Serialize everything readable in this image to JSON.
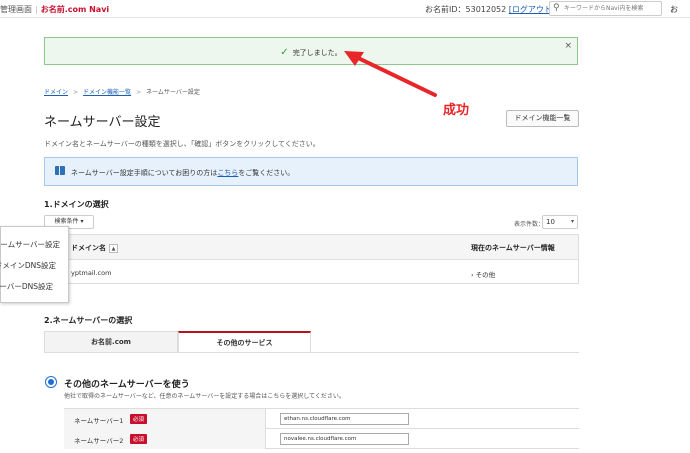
{
  "topbar": {
    "admin_label": "管理画面",
    "separator": "|",
    "navi_label": "お名前.com Navi",
    "account_prefix": "お名前ID：53012052",
    "logout_label": "[ログアウト]",
    "search_placeholder": "キーワードからNavi内を検索",
    "clip_label": "お"
  },
  "success": {
    "message": "完了しました。",
    "close_label": "×"
  },
  "annotation": {
    "label": "成功",
    "color": "#e8262a"
  },
  "breadcrumb": {
    "item1": "ドメイン",
    "item2": "ドメイン機能一覧",
    "item3": "ネームサーバー設定",
    "separator": ">"
  },
  "page": {
    "title": "ネームサーバー設定",
    "list_button": "ドメイン機能一覧",
    "description": "ドメイン名とネームサーバーの種類を選択し、「確認」ボタンをクリックしてください。"
  },
  "info": {
    "text_before": "ネームサーバー設定手順についてお困りの方は",
    "link": "こちら",
    "text_after": "をご覧ください。"
  },
  "domain_section": {
    "title": "1.ドメインの選択",
    "search_condition": "検索条件 ▾",
    "per_page_label": "表示件数：",
    "per_page_value": "10",
    "table": {
      "col_domain": "ドメイン名",
      "col_current": "現在のネームサーバー情報",
      "row_domain": "yptmail.com",
      "row_current": "› その他"
    }
  },
  "popup": {
    "items": [
      "ネームサーバー設定",
      "ドメインDNS設定",
      "サーバーDNS設定"
    ]
  },
  "ns_section": {
    "title": "2.ネームサーバーの選択",
    "tab_onamae": "お名前.com",
    "tab_other": "その他のサービス",
    "radio_label": "その他のネームサーバーを使う",
    "radio_sub": "他社で取得のネームサーバーなど、任意のネームサーバーを設定する場合はこちらを選択してください。",
    "rows": [
      {
        "label": "ネームサーバー1",
        "required": "必須",
        "value": "ethan.ns.cloudflare.com"
      },
      {
        "label": "ネームサーバー2",
        "required": "必須",
        "value": "novalee.ns.cloudflare.com"
      }
    ]
  }
}
